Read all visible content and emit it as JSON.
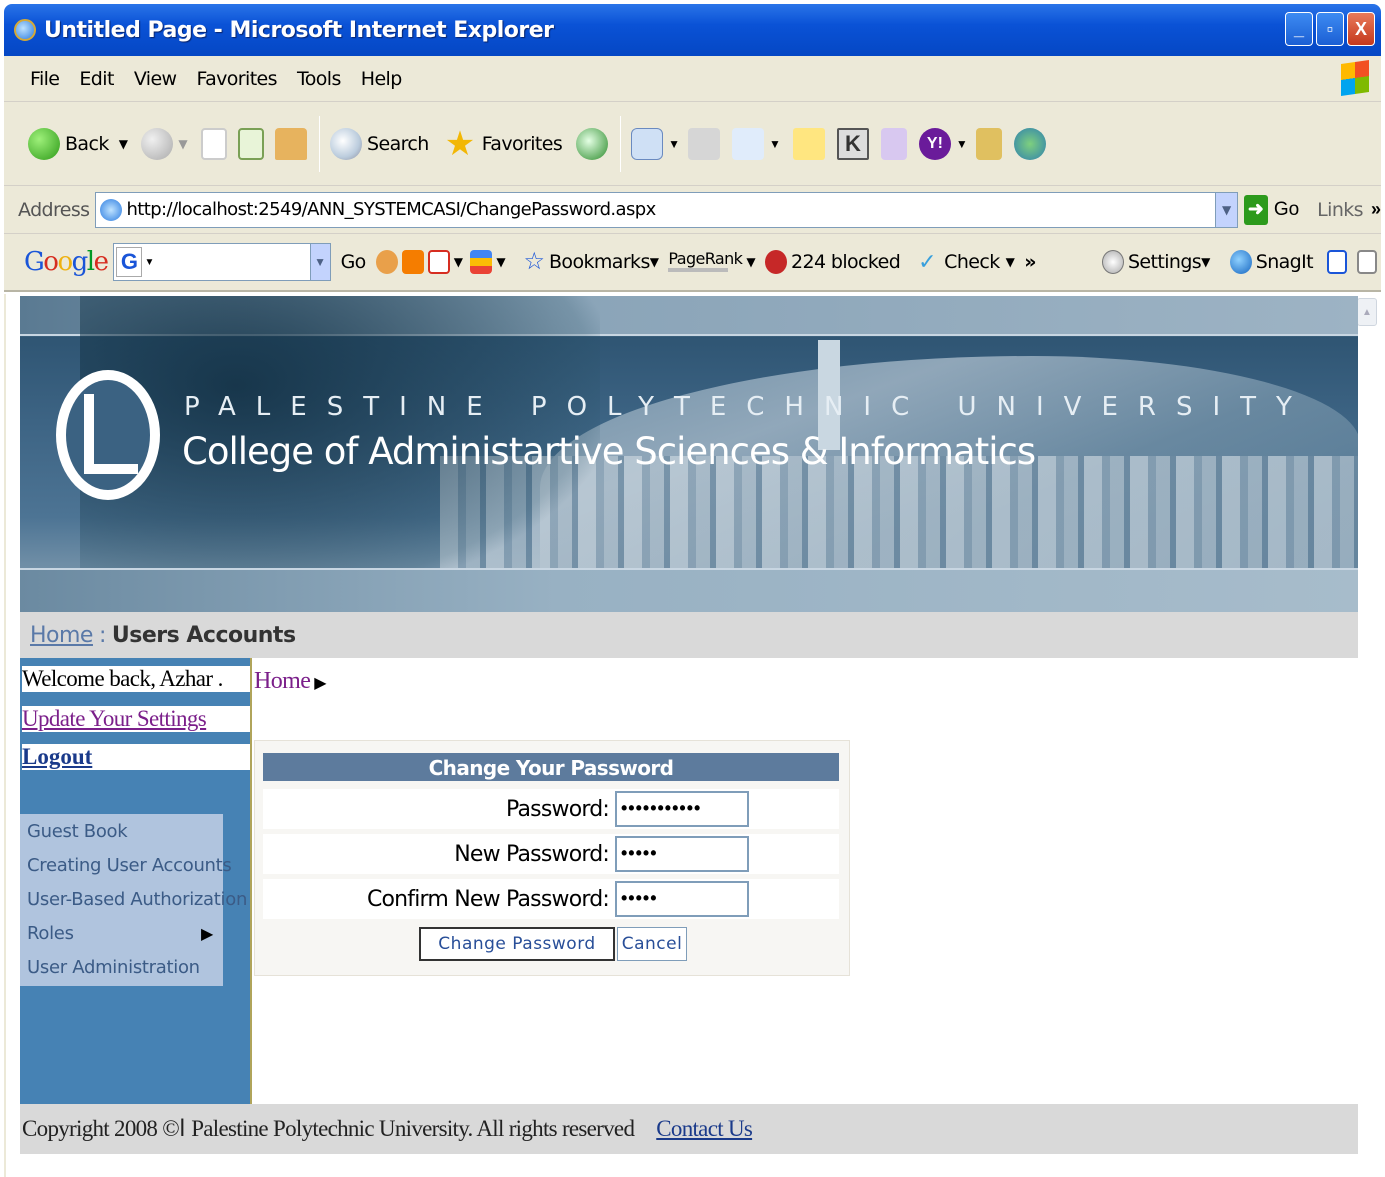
{
  "window": {
    "title": "Untitled Page - Microsoft Internet Explorer",
    "minimize": "_",
    "maximize": "▫",
    "close": "X"
  },
  "menu": [
    "File",
    "Edit",
    "View",
    "Favorites",
    "Tools",
    "Help"
  ],
  "toolbar": {
    "back": "Back",
    "search": "Search",
    "favorites": "Favorites"
  },
  "address": {
    "label": "Address",
    "url": "http://localhost:2549/ANN_SYSTEMCASI/ChangePassword.aspx",
    "go": "Go",
    "links": "Links",
    "more": "»"
  },
  "google": {
    "go": "Go",
    "bookmarks": "Bookmarks",
    "pagerank": "PageRank",
    "blocked": "224 blocked",
    "check": "Check",
    "more": "»",
    "settings": "Settings",
    "snagit": "SnagIt"
  },
  "banner": {
    "university": "PALESTINE POLYTECHNIC UNIVERSITY",
    "college": "College of Administartive Sciences & Informatics"
  },
  "breadcrumb": {
    "home": "Home",
    "sep": ":",
    "current": "Users Accounts"
  },
  "sidebar": {
    "welcome": "Welcome back, Azhar .",
    "update_settings": "Update Your Settings",
    "logout": "Logout",
    "menu": [
      {
        "label": "Guest Book"
      },
      {
        "label": "Creating User Accounts"
      },
      {
        "label": "User-Based Authorization"
      },
      {
        "label": "Roles",
        "arrow": "▶"
      },
      {
        "label": "User Administration"
      }
    ]
  },
  "content_home": "Home",
  "change_password": {
    "title": "Change Your Password",
    "password_label": "Password:",
    "password_value": "•••••••••••",
    "new_label": "New Password:",
    "new_value": "•••••",
    "confirm_label": "Confirm New Password:",
    "confirm_value": "•••••",
    "submit": "Change Password",
    "cancel": "Cancel"
  },
  "footer": {
    "copyright": "Copyright 2008 ©ا Palestine Polytechnic University. All rights reserved",
    "contact": "Contact Us"
  }
}
